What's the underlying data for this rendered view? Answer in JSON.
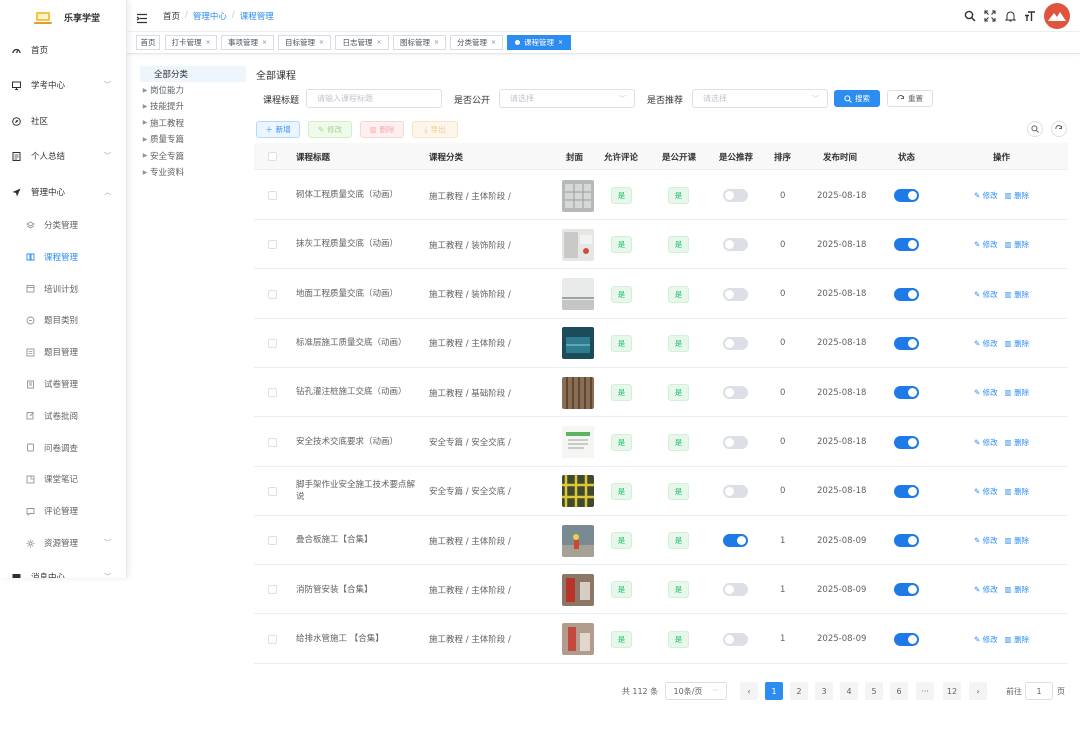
{
  "app": {
    "name": "乐享学堂"
  },
  "sidebar": {
    "items": [
      {
        "label": "首页",
        "icon": "dashboard-icon",
        "chevron": ""
      },
      {
        "label": "学考中心",
        "icon": "monitor-icon",
        "chevron": "﹀"
      },
      {
        "label": "社区",
        "icon": "compass-icon",
        "chevron": ""
      },
      {
        "label": "个人总结",
        "icon": "document-icon",
        "chevron": "﹀"
      },
      {
        "label": "管理中心",
        "icon": "send-icon",
        "chevron": "︿"
      }
    ],
    "subitems": [
      {
        "label": "分类管理",
        "icon": "layers-icon"
      },
      {
        "label": "课程管理",
        "icon": "book-icon"
      },
      {
        "label": "培训计划",
        "icon": "calendar-icon"
      },
      {
        "label": "题目类别",
        "icon": "folder-icon"
      },
      {
        "label": "题目管理",
        "icon": "list-icon"
      },
      {
        "label": "试卷管理",
        "icon": "paper-icon"
      },
      {
        "label": "试卷批阅",
        "icon": "edit-icon"
      },
      {
        "label": "问卷调查",
        "icon": "survey-icon"
      },
      {
        "label": "课堂笔记",
        "icon": "note-icon"
      },
      {
        "label": "评论管理",
        "icon": "comment-icon"
      },
      {
        "label": "资源管理",
        "icon": "resource-icon"
      }
    ],
    "last_item": {
      "label": "消息中心"
    }
  },
  "header": {
    "breadcrumb": [
      "首页",
      "管理中心",
      "课程管理"
    ],
    "breadcrumb_sep": "/"
  },
  "tags": [
    {
      "label": "首页",
      "closable": false,
      "active": false
    },
    {
      "label": "打卡管理",
      "closable": true,
      "active": false
    },
    {
      "label": "事项管理",
      "closable": true,
      "active": false
    },
    {
      "label": "目标管理",
      "closable": true,
      "active": false
    },
    {
      "label": "日志管理",
      "closable": true,
      "active": false
    },
    {
      "label": "图标管理",
      "closable": true,
      "active": false
    },
    {
      "label": "分类管理",
      "closable": true,
      "active": false
    },
    {
      "label": "课程管理",
      "closable": true,
      "active": true
    }
  ],
  "tag_close": "×",
  "tree": {
    "all_label": "全部分类",
    "nodes": [
      "岗位能力",
      "技能提升",
      "施工教程",
      "质量专篇",
      "安全专篇",
      "专业资料"
    ]
  },
  "main": {
    "title": "全部课程",
    "filters": {
      "title_label": "课程标题",
      "title_placeholder": "请输入课程标题",
      "public_label": "是否公开",
      "public_placeholder": "请选择",
      "recommend_label": "是否推荐",
      "recommend_placeholder": "请选择",
      "search_btn": "搜索",
      "reset_btn": "重置"
    },
    "toolbar": {
      "add": "新增",
      "edit": "修改",
      "delete": "删除",
      "export": "导出"
    }
  },
  "table": {
    "headers": [
      "课程标题",
      "课程分类",
      "封面",
      "允许评论",
      "是公开课",
      "是公推荐",
      "排序",
      "发布时间",
      "状态",
      "操作"
    ],
    "yes_label": "是",
    "edit_label": "修改",
    "delete_label": "删除",
    "rows": [
      {
        "title": "砌体工程质量交底（动画）",
        "category": "施工教程 / 主体阶段 /",
        "cover": "cover-wall",
        "comment": "是",
        "public": "是",
        "recommend": false,
        "sort": "0",
        "date": "2025-08-18",
        "status": true
      },
      {
        "title": "抹灰工程质量交底（动画）",
        "category": "施工教程 / 装饰阶段 /",
        "cover": "cover-plaster",
        "comment": "是",
        "public": "是",
        "recommend": false,
        "sort": "0",
        "date": "2025-08-18",
        "status": true
      },
      {
        "title": "地面工程质量交底（动画）",
        "category": "施工教程 / 装饰阶段 /",
        "cover": "cover-floor",
        "comment": "是",
        "public": "是",
        "recommend": false,
        "sort": "0",
        "date": "2025-08-18",
        "status": true
      },
      {
        "title": "标准层施工质量交底（动画）",
        "category": "施工教程 / 主体阶段 /",
        "cover": "cover-floor-std",
        "comment": "是",
        "public": "是",
        "recommend": false,
        "sort": "0",
        "date": "2025-08-18",
        "status": true
      },
      {
        "title": "钻孔灌注桩施工交底（动画）",
        "category": "施工教程 / 基础阶段 /",
        "cover": "cover-pile",
        "comment": "是",
        "public": "是",
        "recommend": false,
        "sort": "0",
        "date": "2025-08-18",
        "status": true
      },
      {
        "title": "安全技术交底要求（动画）",
        "category": "安全专篇 / 安全交底 /",
        "cover": "cover-safety",
        "comment": "是",
        "public": "是",
        "recommend": false,
        "sort": "0",
        "date": "2025-08-18",
        "status": true
      },
      {
        "title": "脚手架作业安全施工技术要点解说",
        "category": "安全专篇 / 安全交底 /",
        "cover": "cover-scaffold",
        "comment": "是",
        "public": "是",
        "recommend": false,
        "sort": "0",
        "date": "2025-08-18",
        "status": true
      },
      {
        "title": "叠合板施工【合集】",
        "category": "施工教程 / 主体阶段 /",
        "cover": "cover-slab",
        "comment": "是",
        "public": "是",
        "recommend": true,
        "sort": "1",
        "date": "2025-08-09",
        "status": true
      },
      {
        "title": "消防管安装【合集】",
        "category": "施工教程 / 主体阶段 /",
        "cover": "cover-fire",
        "comment": "是",
        "public": "是",
        "recommend": false,
        "sort": "1",
        "date": "2025-08-09",
        "status": true
      },
      {
        "title": "给排水管施工 【合集】",
        "category": "施工教程 / 主体阶段 /",
        "cover": "cover-pipe",
        "comment": "是",
        "public": "是",
        "recommend": false,
        "sort": "1",
        "date": "2025-08-09",
        "status": true
      }
    ]
  },
  "pager": {
    "total": "共 112 条",
    "page_size": "10条/页",
    "pages": [
      "1",
      "2",
      "3",
      "4",
      "5",
      "6",
      "···",
      "12"
    ],
    "active": "1",
    "goto_label": "前往",
    "goto_value": "1",
    "page_suffix": "页"
  }
}
